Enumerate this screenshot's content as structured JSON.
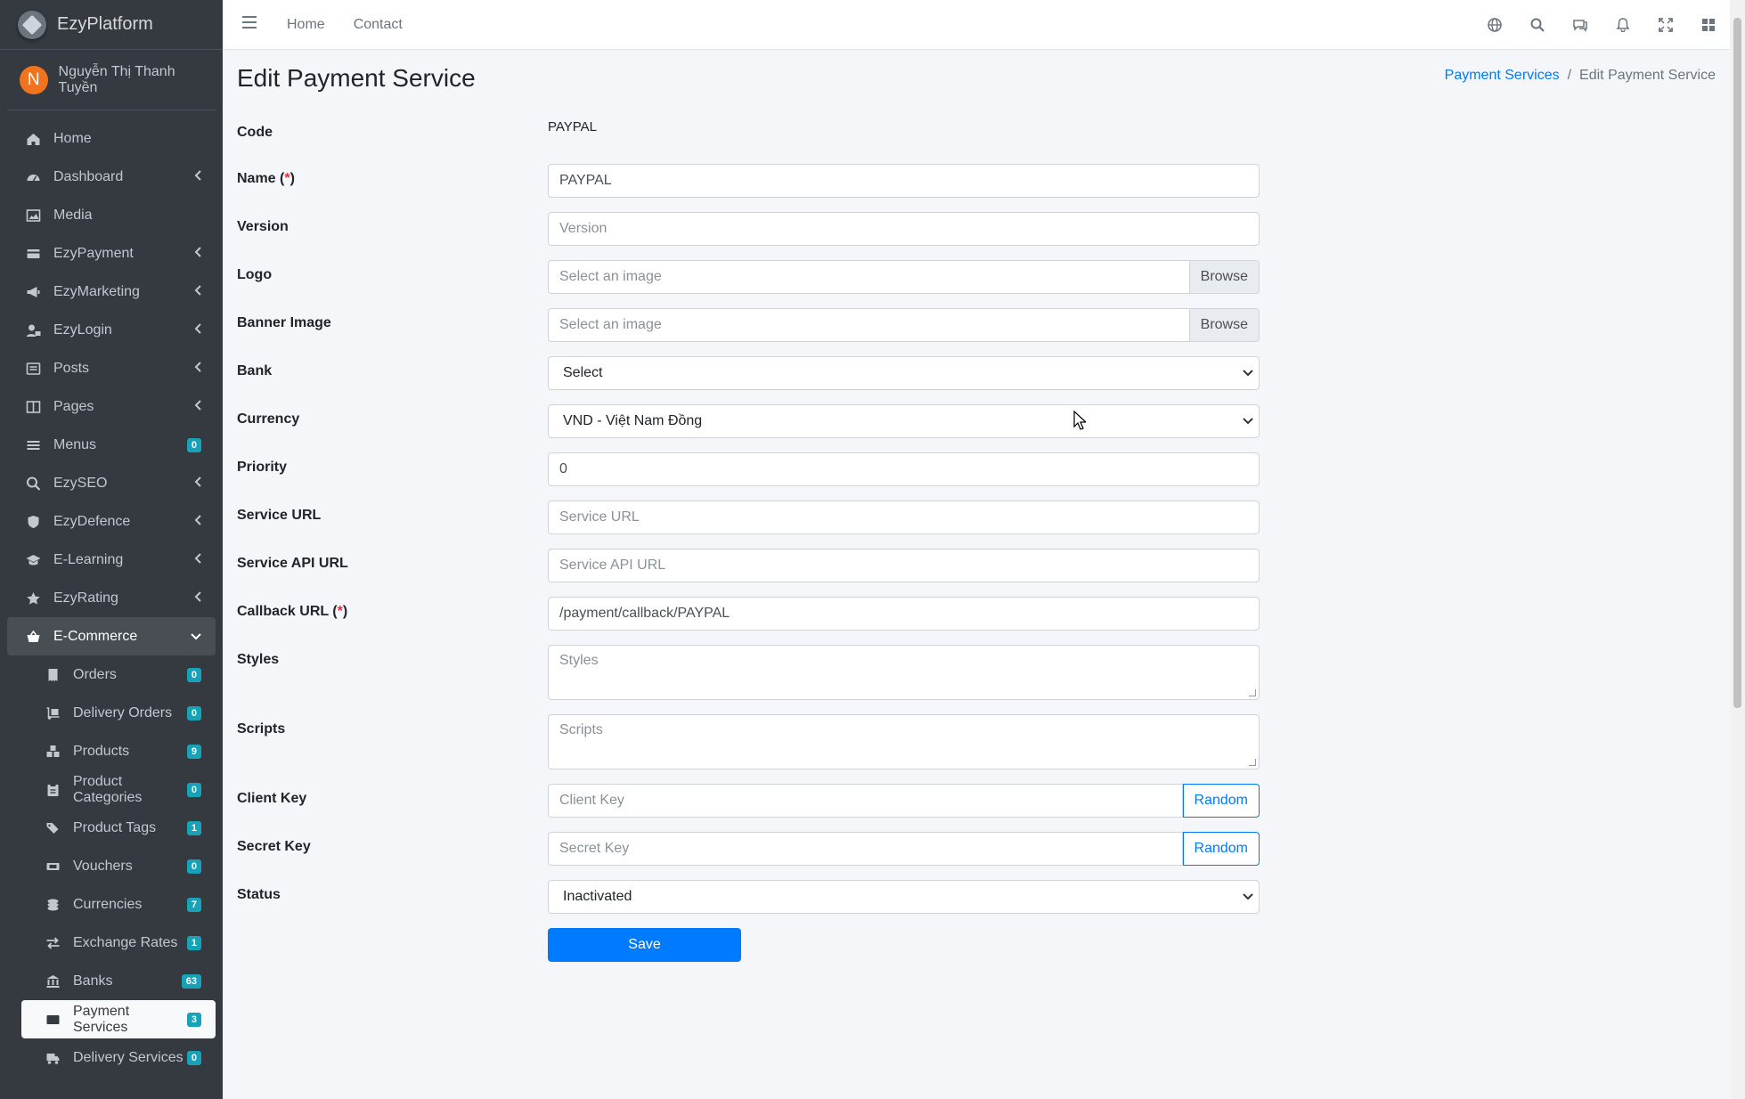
{
  "brand": {
    "name": "EzyPlatform"
  },
  "user": {
    "initial": "N",
    "name": "Nguyễn Thị Thanh Tuyền"
  },
  "sidebar": {
    "items": [
      {
        "label": "Home",
        "icon": "home-icon"
      },
      {
        "label": "Dashboard",
        "icon": "dashboard-icon"
      },
      {
        "label": "Media",
        "icon": "image-icon"
      },
      {
        "label": "EzyPayment",
        "icon": "credit-card-icon"
      },
      {
        "label": "EzyMarketing",
        "icon": "megaphone-icon"
      },
      {
        "label": "EzyLogin",
        "icon": "user-lock-icon"
      },
      {
        "label": "Posts",
        "icon": "posts-icon"
      },
      {
        "label": "Pages",
        "icon": "pages-icon"
      },
      {
        "label": "Menus",
        "icon": "bars-icon",
        "badge": "0"
      },
      {
        "label": "EzySEO",
        "icon": "search-plus-icon"
      },
      {
        "label": "EzyDefence",
        "icon": "shield-icon"
      },
      {
        "label": "E-Learning",
        "icon": "graduation-cap-icon"
      },
      {
        "label": "EzyRating",
        "icon": "star-icon"
      },
      {
        "label": "E-Commerce",
        "icon": "basket-icon"
      }
    ],
    "sub_items": [
      {
        "label": "Orders",
        "badge": "0",
        "icon": "receipt-icon"
      },
      {
        "label": "Delivery Orders",
        "badge": "0",
        "icon": "dolly-icon"
      },
      {
        "label": "Products",
        "badge": "9",
        "icon": "boxes-icon"
      },
      {
        "label": "Product Categories",
        "badge": "0",
        "icon": "clipboard-list-icon"
      },
      {
        "label": "Product Tags",
        "badge": "1",
        "icon": "tags-icon"
      },
      {
        "label": "Vouchers",
        "badge": "0",
        "icon": "ticket-icon"
      },
      {
        "label": "Currencies",
        "badge": "7",
        "icon": "coins-icon"
      },
      {
        "label": "Exchange Rates",
        "badge": "1",
        "icon": "exchange-icon"
      },
      {
        "label": "Banks",
        "badge": "63",
        "icon": "bank-icon"
      },
      {
        "label": "Payment Services",
        "badge": "3",
        "icon": "credit-card-icon"
      },
      {
        "label": "Delivery Services",
        "badge": "0",
        "icon": "truck-icon"
      }
    ]
  },
  "topbar": {
    "links": [
      "Home",
      "Contact"
    ],
    "icons": [
      "globe-icon",
      "search-icon",
      "comments-icon",
      "bell-icon",
      "fullscreen-icon",
      "apps-icon"
    ]
  },
  "page": {
    "title": "Edit Payment Service",
    "breadcrumb": {
      "link": "Payment Services",
      "separator": "/",
      "current": "Edit Payment Service"
    }
  },
  "form": {
    "code": {
      "label": "Code",
      "value": "PAYPAL"
    },
    "name": {
      "label": "Name (",
      "req": "*",
      "label_end": ")",
      "value": "PAYPAL"
    },
    "version": {
      "label": "Version",
      "placeholder": "Version"
    },
    "logo": {
      "label": "Logo",
      "placeholder": "Select an image",
      "button": "Browse"
    },
    "banner": {
      "label": "Banner Image",
      "placeholder": "Select an image",
      "button": "Browse"
    },
    "bank": {
      "label": "Bank",
      "value": "Select"
    },
    "currency": {
      "label": "Currency",
      "value": "VND - Việt Nam Đồng"
    },
    "priority": {
      "label": "Priority",
      "value": "0"
    },
    "service_url": {
      "label": "Service URL",
      "placeholder": "Service URL"
    },
    "service_api_url": {
      "label": "Service API URL",
      "placeholder": "Service API URL"
    },
    "callback_url": {
      "label": "Callback URL (",
      "req": "*",
      "label_end": ")",
      "value": "/payment/callback/PAYPAL"
    },
    "styles": {
      "label": "Styles",
      "placeholder": "Styles"
    },
    "scripts": {
      "label": "Scripts",
      "placeholder": "Scripts"
    },
    "client_key": {
      "label": "Client Key",
      "placeholder": "Client Key",
      "button": "Random"
    },
    "secret_key": {
      "label": "Secret Key",
      "placeholder": "Secret Key",
      "button": "Random"
    },
    "status": {
      "label": "Status",
      "value": "Inactivated"
    },
    "save": "Save"
  },
  "colors": {
    "sidebar_bg": "#343a40",
    "primary": "#007bff",
    "badge": "#17a2b8",
    "required": "#dc3545"
  }
}
